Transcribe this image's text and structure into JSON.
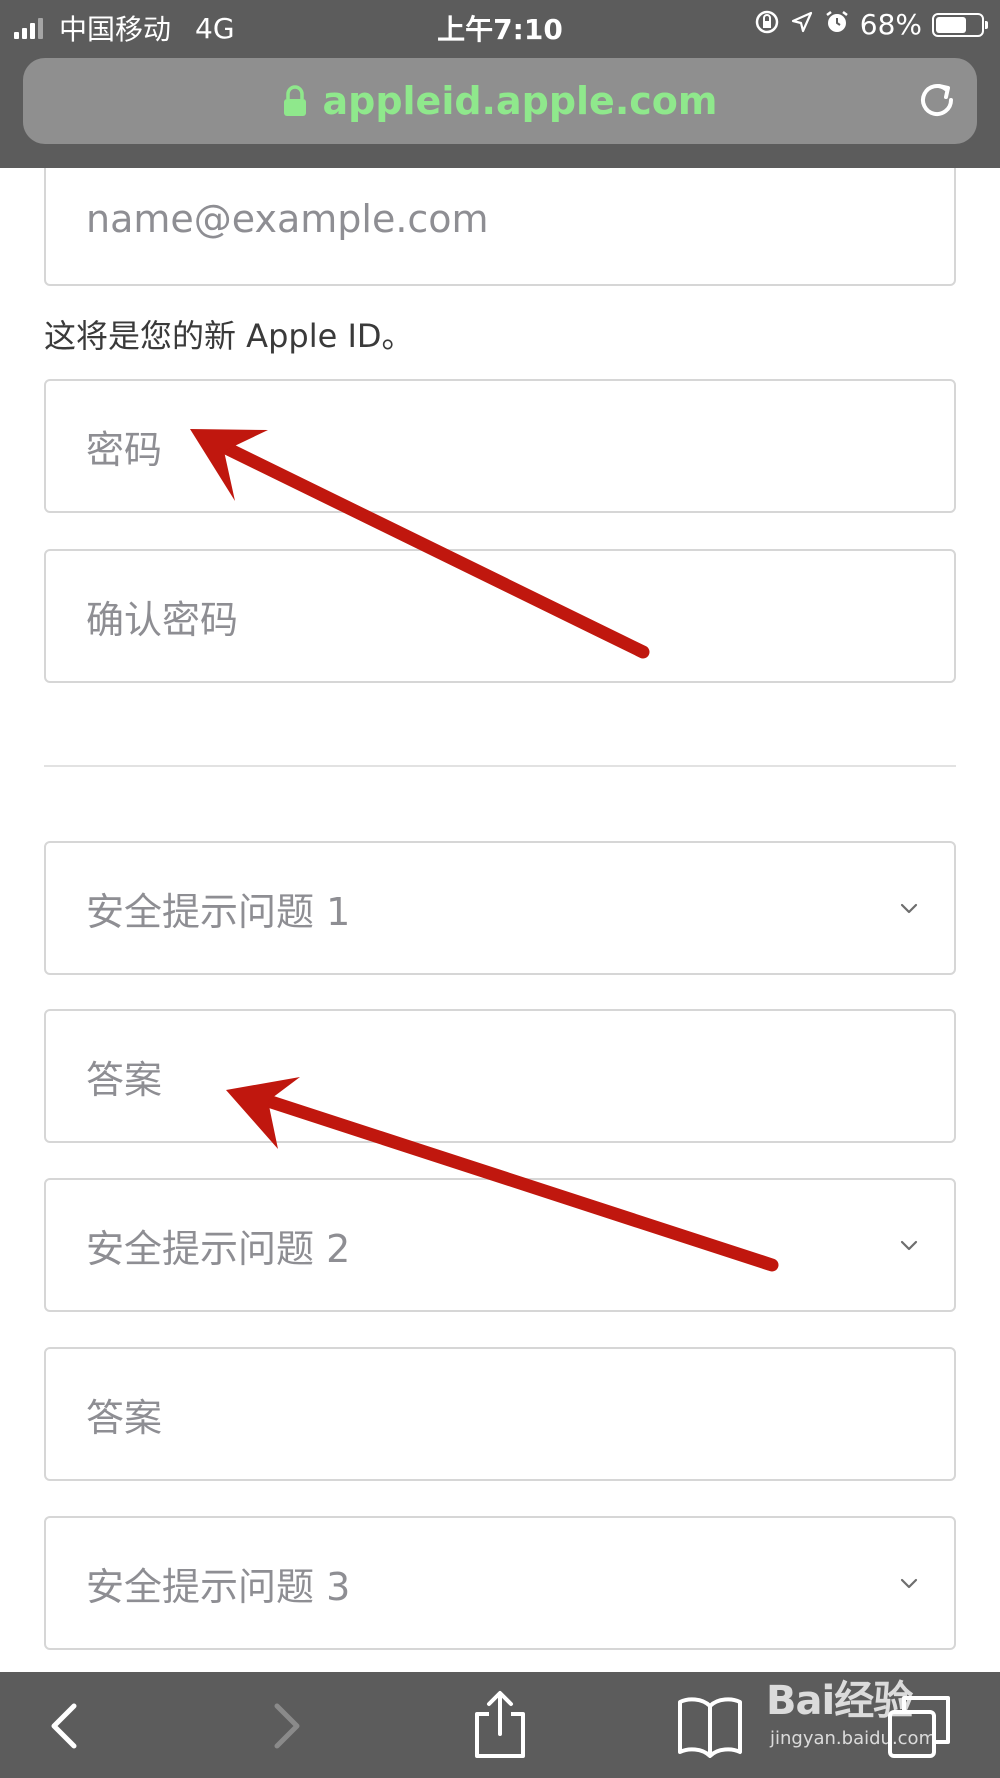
{
  "status_bar": {
    "carrier": "中国移动",
    "network": "4G",
    "time": "上午7:10",
    "battery": "68%",
    "battery_level": 0.68,
    "icons": [
      "rotation-lock-icon",
      "location-icon",
      "alarm-icon"
    ]
  },
  "browser": {
    "url": "appleid.apple.com",
    "url_color": "#8fe88c",
    "lock_icon": "lock-icon",
    "reload_icon": "reload-icon"
  },
  "form": {
    "email_placeholder": "name@example.com",
    "helper_text": "这将是您的新 Apple ID。",
    "password_placeholder": "密码",
    "confirm_password_placeholder": "确认密码",
    "security_questions": [
      {
        "question_placeholder": "安全提示问题 1",
        "answer_placeholder": "答案"
      },
      {
        "question_placeholder": "安全提示问题 2",
        "answer_placeholder": "答案"
      },
      {
        "question_placeholder": "安全提示问题 3"
      }
    ]
  },
  "annotations": {
    "arrow_color": "#c0170e",
    "arrow_count": 2
  },
  "toolbar": {
    "buttons": [
      "back-icon",
      "forward-icon",
      "share-icon",
      "bookmarks-icon",
      "tabs-icon"
    ]
  },
  "watermark": {
    "brand": "Bai经验",
    "domain": "jingyan.baidu.com"
  }
}
